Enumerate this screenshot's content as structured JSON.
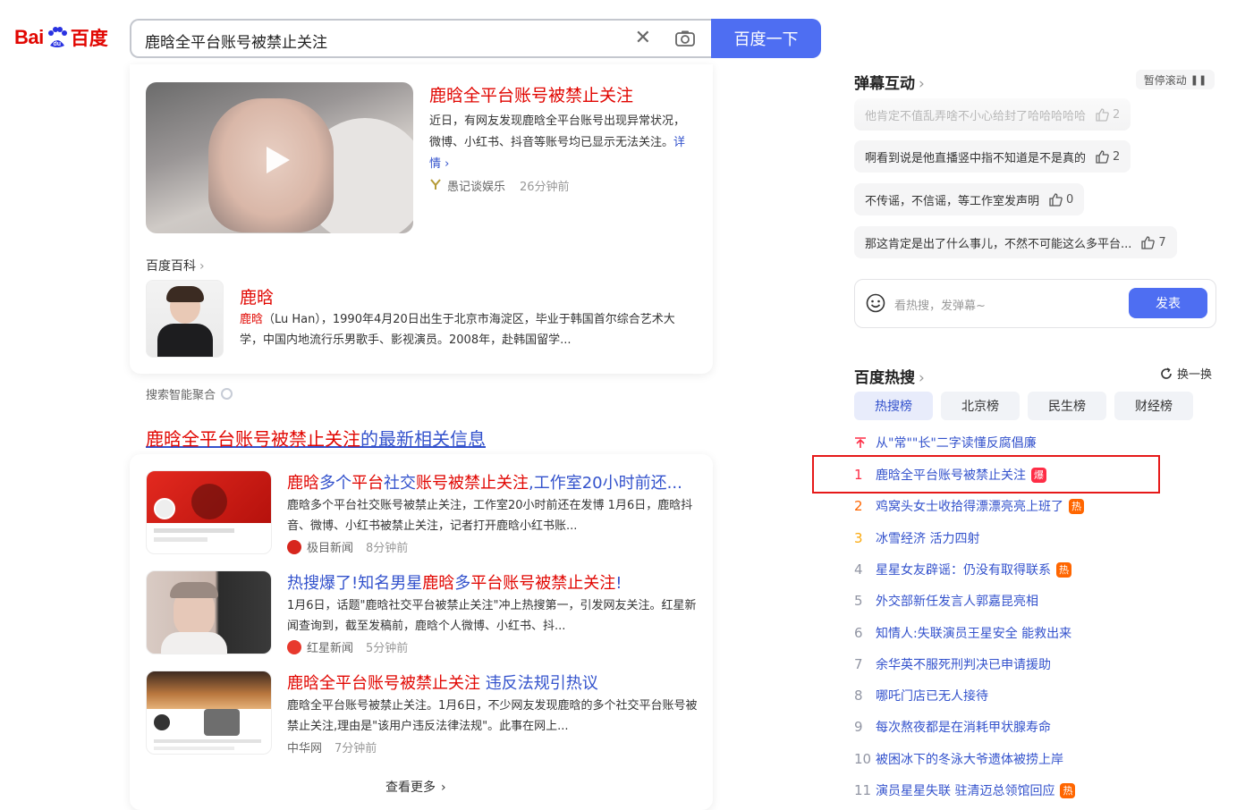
{
  "header": {
    "logo_bai": "Bai",
    "logo_du": "百度",
    "query": "鹿晗全平台账号被禁止关注",
    "search_button": "百度一下"
  },
  "news_card": {
    "title": "鹿晗全平台账号被禁止关注",
    "desc": "近日，有网友发现鹿晗全平台账号出现异常状况，微博、小红书、抖音等账号均已显示无法关注。",
    "more": "详情 ›",
    "source": "愚记谈娱乐",
    "time": "26分钟前"
  },
  "baike": {
    "label": "百度百科",
    "name": "鹿晗",
    "desc_name": "鹿晗",
    "desc": "（Lu Han），1990年4月20日出生于北京市海淀区，毕业于韩国首尔综合艺术大学，中国内地流行乐男歌手、影视演员。2008年，赴韩国留学..."
  },
  "aggregation_label": "搜索智能聚合",
  "related": {
    "title_red": "鹿晗全平台账号被禁止关注",
    "title_rest": "的最新相关信息",
    "items": [
      {
        "title_parts": [
          {
            "text": "鹿晗",
            "red": true
          },
          {
            "text": "多个",
            "red": false
          },
          {
            "text": "平台",
            "red": true
          },
          {
            "text": "社交",
            "red": false
          },
          {
            "text": "账号被禁止关注",
            "red": true
          },
          {
            "text": ",工作室20小时前还...",
            "red": false
          }
        ],
        "desc": "鹿晗多个平台社交账号被禁止关注，工作室20小时前还在发博 1月6日，鹿晗抖音、微博、小红书被禁止关注，记者打开鹿晗小红书账...",
        "source": "极目新闻",
        "time": "8分钟前",
        "icon_color": "#d7261d"
      },
      {
        "title_parts": [
          {
            "text": "热搜爆了!知名男星",
            "red": false
          },
          {
            "text": "鹿晗",
            "red": true
          },
          {
            "text": "多",
            "red": false
          },
          {
            "text": "平台账号被禁止关注",
            "red": true
          },
          {
            "text": "!",
            "red": false
          }
        ],
        "desc": "1月6日，话题\"鹿晗社交平台被禁止关注\"冲上热搜第一，引发网友关注。红星新闻查询到，截至发稿前，鹿晗个人微博、小红书、抖...",
        "source": "红星新闻",
        "time": "5分钟前",
        "icon_color": "#e8392d"
      },
      {
        "title_parts": [
          {
            "text": "鹿晗全平台账号被禁止关注",
            "red": true
          },
          {
            "text": " 违反法规引热议",
            "red": false
          }
        ],
        "desc": "鹿晗全平台账号被禁止关注。1月6日，不少网友发现鹿晗的多个社交平台账号被禁止关注,理由是\"该用户违反法律法规\"。此事在网上...",
        "source": "中华网",
        "time": "7分钟前",
        "icon_color": ""
      }
    ],
    "view_more": "查看更多"
  },
  "danmu": {
    "title": "弹幕互动",
    "pause": "暂停滚动",
    "messages": [
      {
        "text": "他肯定不值乱弄啥不小心给封了哈哈哈哈哈",
        "likes": "2"
      },
      {
        "text": "啊看到说是他直播竖中指不知道是不是真的",
        "likes": "2"
      },
      {
        "text": "不传谣，不信谣，等工作室发声明",
        "likes": "0"
      },
      {
        "text": "那这肯定是出了什么事儿，不然不可能这么多平台...",
        "likes": "7"
      }
    ],
    "placeholder": "看热搜，发弹幕~",
    "send": "发表"
  },
  "hot": {
    "title": "百度热搜",
    "refresh": "换一换",
    "tabs": [
      "热搜榜",
      "北京榜",
      "民生榜",
      "财经榜"
    ],
    "pinned": "从\"常\"\"长\"二字读懂反腐倡廉",
    "items": [
      {
        "rank": "1",
        "text": "鹿晗全平台账号被禁止关注",
        "badge": "爆",
        "rank_color": "#fe2d46",
        "badge_color": "#fe2d46"
      },
      {
        "rank": "2",
        "text": "鸡窝头女士收拾得漂漂亮亮上班了",
        "badge": "热",
        "rank_color": "#f60",
        "badge_color": "#ff6600"
      },
      {
        "rank": "3",
        "text": "冰雪经济 活力四射",
        "badge": "",
        "rank_color": "#faa90e",
        "badge_color": ""
      },
      {
        "rank": "4",
        "text": "星星女友辟谣：仍没有取得联系",
        "badge": "热",
        "rank_color": "#9195a3",
        "badge_color": "#ff6600"
      },
      {
        "rank": "5",
        "text": "外交部新任发言人郭嘉昆亮相",
        "badge": "",
        "rank_color": "#9195a3",
        "badge_color": ""
      },
      {
        "rank": "6",
        "text": "知情人:失联演员王星安全 能救出来",
        "badge": "",
        "rank_color": "#9195a3",
        "badge_color": ""
      },
      {
        "rank": "7",
        "text": "余华英不服死刑判决已申请援助",
        "badge": "",
        "rank_color": "#9195a3",
        "badge_color": ""
      },
      {
        "rank": "8",
        "text": "哪吒门店已无人接待",
        "badge": "",
        "rank_color": "#9195a3",
        "badge_color": ""
      },
      {
        "rank": "9",
        "text": "每次熬夜都是在消耗甲状腺寿命",
        "badge": "",
        "rank_color": "#9195a3",
        "badge_color": ""
      },
      {
        "rank": "10",
        "text": "被困冰下的冬泳大爷遗体被捞上岸",
        "badge": "",
        "rank_color": "#9195a3",
        "badge_color": ""
      },
      {
        "rank": "11",
        "text": "演员星星失联 驻清迈总领馆回应",
        "badge": "热",
        "rank_color": "#9195a3",
        "badge_color": "#ff6600"
      }
    ]
  }
}
